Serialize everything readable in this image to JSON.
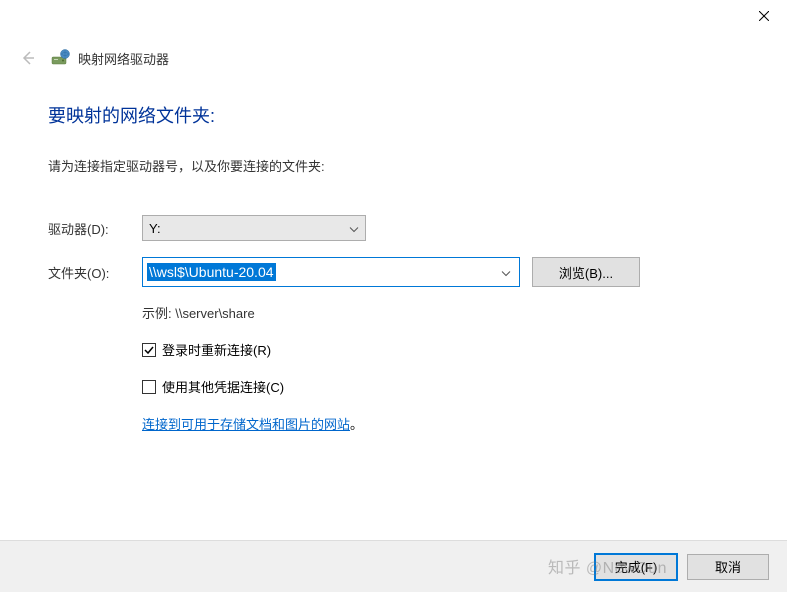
{
  "titlebar": {
    "window_title": "映射网络驱动器"
  },
  "heading": "要映射的网络文件夹:",
  "instruction": "请为连接指定驱动器号，以及你要连接的文件夹:",
  "form": {
    "drive_label": "驱动器(D):",
    "drive_value": "Y:",
    "folder_label": "文件夹(O):",
    "folder_value": "\\\\wsl$\\Ubuntu-20.04",
    "browse_label": "浏览(B)...",
    "example_text": "示例: \\\\server\\share",
    "reconnect_label": "登录时重新连接(R)",
    "reconnect_checked": true,
    "credentials_label": "使用其他凭据连接(C)",
    "credentials_checked": false,
    "link_text": "连接到可用于存储文档和图片的网站",
    "link_suffix": "。"
  },
  "footer": {
    "finish_label": "完成(F)",
    "cancel_label": "取消"
  },
  "watermark": "知乎 @NewDun"
}
